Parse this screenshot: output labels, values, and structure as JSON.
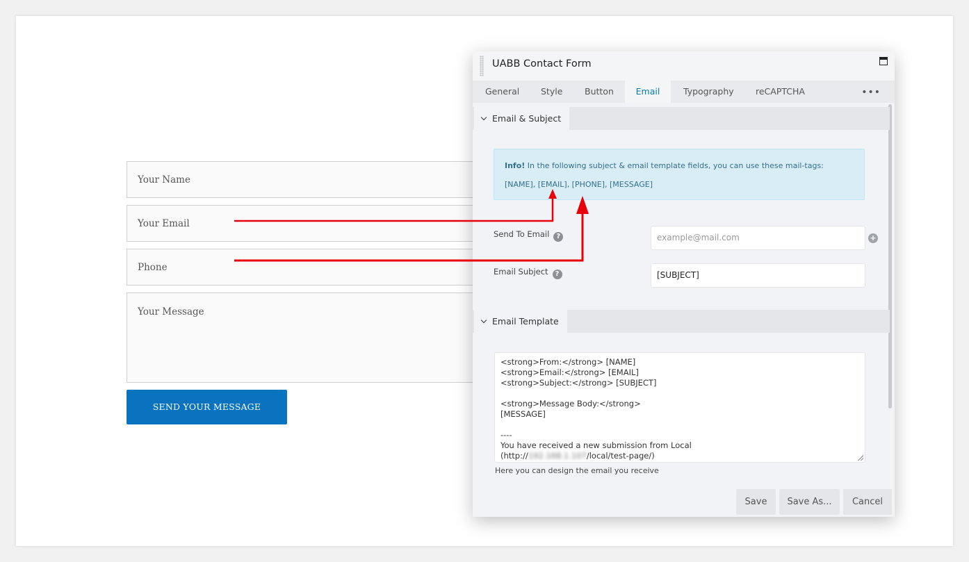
{
  "form": {
    "name_placeholder": "Your Name",
    "email_placeholder": "Your Email",
    "phone_placeholder": "Phone",
    "message_placeholder": "Your Message",
    "submit_label": "SEND YOUR MESSAGE"
  },
  "panel": {
    "title": "UABB Contact Form",
    "tabs": [
      "General",
      "Style",
      "Button",
      "Email",
      "Typography",
      "reCAPTCHA"
    ],
    "active_tab": "Email",
    "sections": {
      "email_subject": {
        "title": "Email & Subject",
        "info_strong": "Info!",
        "info_text": " In the following subject & email template fields, you can use these mail-tags:",
        "info_tags": "[NAME], [EMAIL], [PHONE], [MESSAGE]",
        "send_to_label": "Send To Email",
        "send_to_placeholder": "example@mail.com",
        "subject_label": "Email Subject",
        "subject_value": "[SUBJECT]"
      },
      "email_template": {
        "title": "Email Template",
        "lines": [
          "<strong>From:</strong> [NAME]",
          "<strong>Email:</strong> [EMAIL]",
          "<strong>Subject:</strong> [SUBJECT]",
          "",
          "<strong>Message Body:</strong>",
          "[MESSAGE]",
          "",
          "----",
          "You have received a new submission from Local"
        ],
        "url_prefix": "(http://",
        "url_host_blurred": "192.168.1.107",
        "url_suffix": "/local/test-page/)",
        "help": "Here you can design the email you receive"
      }
    },
    "buttons": {
      "save": "Save",
      "save_as": "Save As...",
      "cancel": "Cancel"
    }
  },
  "colors": {
    "accent": "#0a7cab",
    "submit_button": "#0a73bf",
    "arrow": "#e8000b",
    "info_bg": "#d9edf7"
  },
  "icons": [
    "drag-handle-icon",
    "maximize-icon",
    "more-icon",
    "chevron-down-icon",
    "help-icon",
    "plus-icon",
    "resize-icon"
  ]
}
